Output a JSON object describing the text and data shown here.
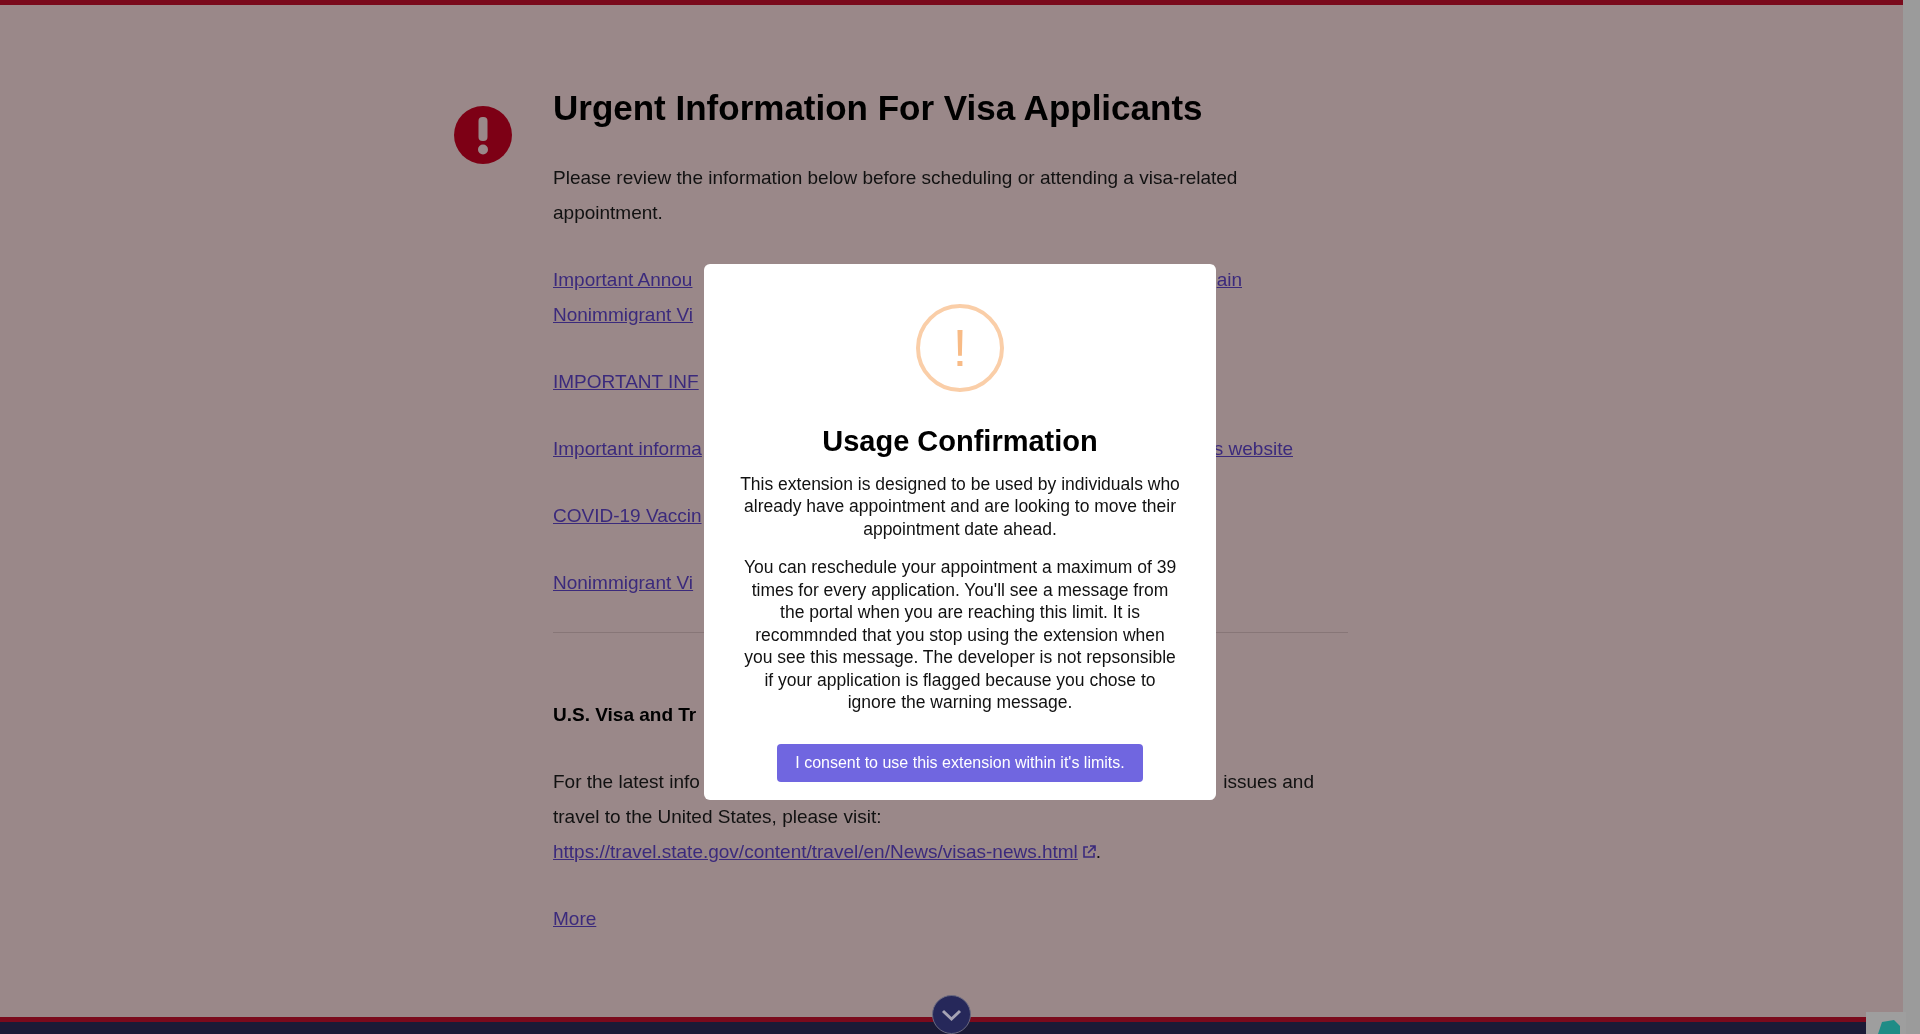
{
  "page": {
    "title": "Urgent Information For Visa Applicants",
    "intro": "Please review the information below before scheduling or attending a visa-related appointment.",
    "links": [
      {
        "lines": [
          {
            "left": "Important Annou",
            "right": "ain"
          },
          {
            "left": "Nonimmigrant Vi"
          }
        ]
      },
      {
        "lines": [
          {
            "left": "IMPORTANT INF"
          }
        ]
      },
      {
        "lines": [
          {
            "left": "Important informa",
            "right": "s website"
          }
        ]
      },
      {
        "lines": [
          {
            "left": "COVID-19 Vaccin"
          }
        ]
      },
      {
        "lines": [
          {
            "left": "Nonimmigrant Vi"
          }
        ]
      }
    ],
    "section_heading": "U.S. Visa and Tr",
    "paragraph_lines": [
      {
        "left": "For the latest info",
        "right": "issues and"
      },
      {
        "left": "travel to the United States, please visit:"
      }
    ],
    "url_link": "https://travel.state.gov/content/travel/en/News/visas-news.html",
    "url_trailing": ".",
    "more_link": "More"
  },
  "modal": {
    "title": "Usage Confirmation",
    "paragraphs": [
      "This extension is designed to be used by individuals who already have appointment and are looking to move their appointment date ahead.",
      "You can reschedule your appointment a maximum of 39 times for every application. You'll see a message from the portal when you are reaching this limit. It is recommnded that you stop using the extension when you see this message. The developer is not repsonsible if your application is flagged because you chose to ignore the warning message."
    ],
    "icon": "!",
    "button": "I consent to use this extension within it's limits."
  }
}
